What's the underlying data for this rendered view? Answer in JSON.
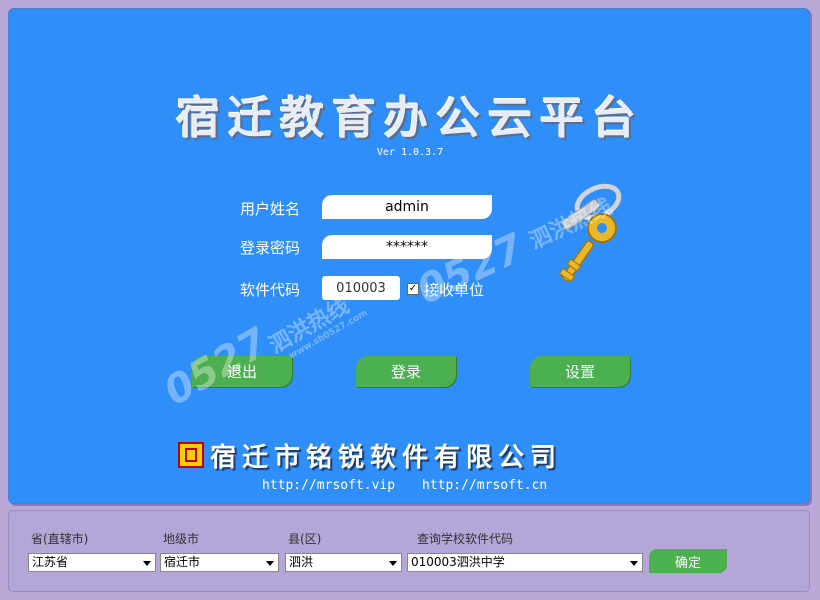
{
  "app": {
    "title": "宿迁教育办公云平台",
    "version": "Ver 1.0.3.7"
  },
  "login": {
    "username_label": "用户姓名",
    "username_value": "admin",
    "password_label": "登录密码",
    "password_value": "******",
    "code_label": "软件代码",
    "code_value": "010003",
    "receive_checked": true,
    "receive_label": "接收单位"
  },
  "buttons": {
    "exit": "退出",
    "login": "登录",
    "settings": "设置"
  },
  "footer": {
    "company": "宿迁市铭锐软件有限公司",
    "url1": "http://mrsoft.vip",
    "url2": "http://mrsoft.cn"
  },
  "query": {
    "province_label": "省(直辖市)",
    "province_value": "江苏省",
    "city_label": "地级市",
    "city_value": "宿迁市",
    "county_label": "县(区)",
    "county_value": "泗洪",
    "school_label": "查询学校软件代码",
    "school_value": "010003泗洪中学",
    "confirm": "确定"
  },
  "watermark": {
    "number": "0527",
    "text": "泗洪热线",
    "url": "www.sh0527.com"
  },
  "icons": {
    "key": "key-icon",
    "logo": "company-logo-icon"
  },
  "colors": {
    "main_bg": "#2f8ef7",
    "outer_bg": "#b8a9d8",
    "button": "#4caf50"
  }
}
